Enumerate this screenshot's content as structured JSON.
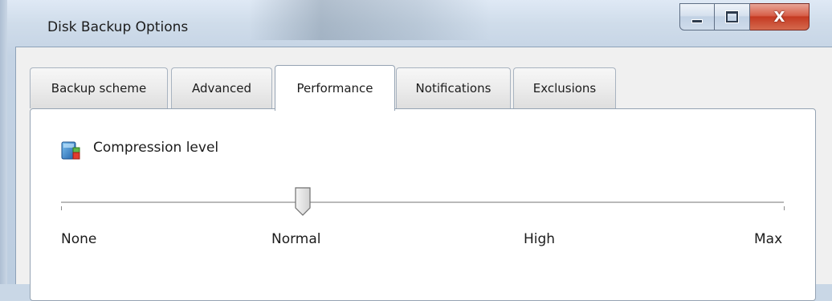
{
  "window": {
    "title": "Disk Backup Options",
    "controls": {
      "minimize": "minimize",
      "maximize": "maximize",
      "close": "X"
    }
  },
  "tabs": [
    {
      "label": "Backup scheme",
      "active": false
    },
    {
      "label": "Advanced",
      "active": false
    },
    {
      "label": "Performance",
      "active": true
    },
    {
      "label": "Notifications",
      "active": false
    },
    {
      "label": "Exclusions",
      "active": false
    }
  ],
  "compression": {
    "section_label": "Compression level",
    "icon": "compression-level-icon",
    "slider": {
      "levels": [
        "None",
        "Normal",
        "High",
        "Max"
      ],
      "selected_index": 1,
      "value_fraction": 0.33
    }
  },
  "colors": {
    "close_button": "#c43a22",
    "panel_background": "#ffffff",
    "frame_background": "#c9d7e6"
  }
}
